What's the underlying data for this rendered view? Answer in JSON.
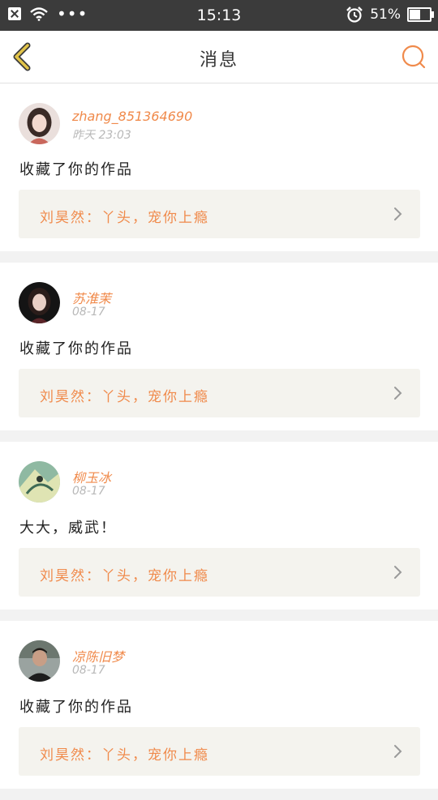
{
  "status_bar": {
    "dots": "•••",
    "time": "15:13",
    "battery_text": "51%",
    "battery_level": 0.51
  },
  "header": {
    "title": "消息",
    "back_icon": "chevron-left-icon",
    "search_icon": "search-icon"
  },
  "colors": {
    "accent": "#f08a4b",
    "back_icon": "#e2c44a",
    "card_link_bg": "#f4f3ee"
  },
  "messages": [
    {
      "name": "zhang_851364690",
      "time": "昨天 23:03",
      "text": "收藏了你的作品",
      "work": "刘昊然：丫头，宠你上瘾"
    },
    {
      "name": "苏淮茉",
      "time": "08-17",
      "text": "收藏了你的作品",
      "work": "刘昊然：丫头，宠你上瘾"
    },
    {
      "name": "柳玉冰",
      "time": "08-17",
      "text": "大大，威武！",
      "work": "刘昊然：丫头，宠你上瘾"
    },
    {
      "name": "凉陈旧梦",
      "time": "08-17",
      "text": "收藏了你的作品",
      "work": "刘昊然：丫头，宠你上瘾"
    }
  ]
}
